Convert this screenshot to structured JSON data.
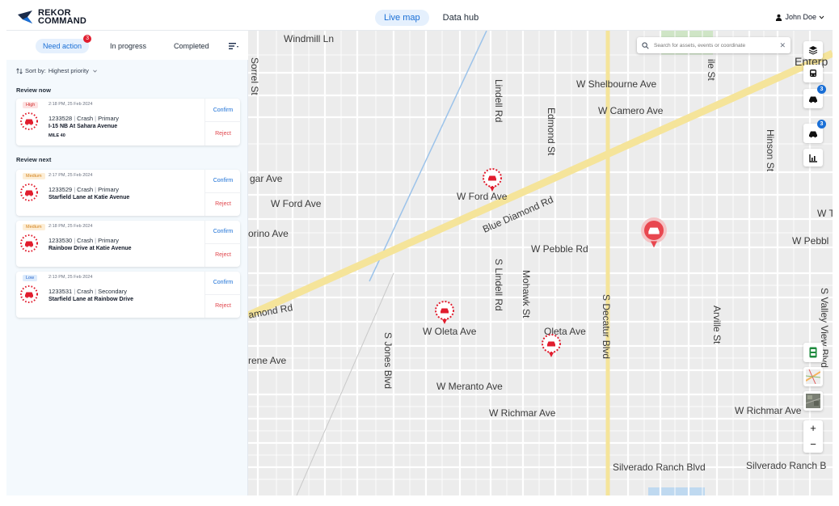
{
  "brand": {
    "line1": "REKOR",
    "line2": "COMMAND"
  },
  "nav": {
    "tabs": [
      "Live map",
      "Data hub"
    ],
    "active": "Live map"
  },
  "user": {
    "name": "John Doe"
  },
  "sidebar": {
    "tabs": [
      {
        "label": "Need action",
        "badge": "3"
      },
      {
        "label": "In progress"
      },
      {
        "label": "Completed"
      }
    ],
    "sort_label": "Sort by:",
    "sort_value": "Highest priority",
    "review_now_title": "Review now",
    "review_next_title": "Review next",
    "cards": [
      {
        "priority": "High",
        "time": "2:18 PM, 25 Feb 2024",
        "id": "1233528",
        "type": "Crash",
        "category": "Primary",
        "location": "I-15 NB At Sahara Avenue",
        "mile": "MILE 40",
        "confirm": "Confirm",
        "reject": "Reject"
      },
      {
        "priority": "Medium",
        "time": "2:17 PM, 25 Feb 2024",
        "id": "1233529",
        "type": "Crash",
        "category": "Primary",
        "location": "Starfield Lane at Katie Avenue",
        "confirm": "Confirm",
        "reject": "Reject"
      },
      {
        "priority": "Medium",
        "time": "2:18 PM, 25 Feb 2024",
        "id": "1233530",
        "type": "Crash",
        "category": "Primary",
        "location": "Rainbow Drive at Katie Avenue",
        "confirm": "Confirm",
        "reject": "Reject"
      },
      {
        "priority": "Low",
        "time": "2:13 PM, 25 Feb 2024",
        "id": "1233531",
        "type": "Crash",
        "category": "Secondary",
        "location": "Starfield Lane at Rainbow Drive",
        "confirm": "Confirm",
        "reject": "Reject"
      }
    ]
  },
  "map": {
    "search_placeholder": "Search for assets, events or coordinate",
    "street_labels": {
      "windmill": "Windmill Ln",
      "sorrel": "Sorrel St",
      "lindell": "Lindell Rd",
      "edmond": "Edmond St",
      "shelbourne": "W Shelbourne Ave",
      "camero": "W Camero Ave",
      "enterprise": "Enterp",
      "ile": "ile St",
      "hinson": "Hinson St",
      "gar": "gar Ave",
      "wford": "W Ford Ave",
      "wford2": "W Ford Ave",
      "wt": "W T",
      "blue_diamond": "Blue Diamond Rd",
      "orino": "orino Ave",
      "pebble": "W Pebble Rd",
      "pebble2": "W Pebbl",
      "slindell": "S Lindell Rd",
      "mohawk": "Mohawk St",
      "sdecatur": "S Decatur Blvd",
      "arville": "Arville St",
      "svalley": "S Valley View Blvd",
      "amond": "amond Rd",
      "oleta": "W Oleta Ave",
      "oleta2": "Oleta Ave",
      "sjones": "S Jones Blvd",
      "rene": "rene Ave",
      "meranto": "W Meranto Ave",
      "richmar": "W Richmar Ave",
      "richmar2": "W Richmar Ave",
      "silverado": "Silverado Ranch Blvd",
      "silverado2": "Silverado Ranch B"
    },
    "controls": {
      "layers_badge": "3",
      "incidents_badge": "3"
    },
    "zoom_in": "+",
    "zoom_out": "−",
    "colors": {
      "accent": "#1a6fd6",
      "alert": "#e11d2e",
      "road_major": "#f5e49a",
      "map_bg": "#ececec"
    }
  }
}
